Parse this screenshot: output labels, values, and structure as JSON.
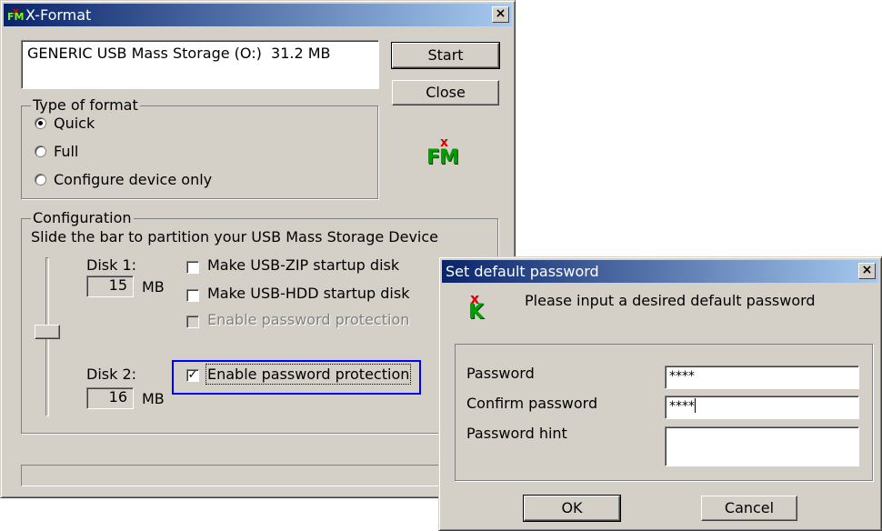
{
  "xformat": {
    "title": "X-Format",
    "close_glyph": "×",
    "device_text": "GENERIC USB Mass Storage (O:)  31.2 MB",
    "start_label": "Start",
    "close_label": "Close",
    "type_of_format": {
      "label": "Type of format",
      "options": [
        "Quick",
        "Full",
        "Configure device only"
      ],
      "selected": "Quick"
    },
    "logo_text": "FM",
    "logo_x": "x",
    "configuration": {
      "label": "Configuration",
      "instruction": "Slide the bar to partition your USB Mass Storage Device",
      "disk1_label": "Disk 1:",
      "disk1_value": "15",
      "disk1_unit": "MB",
      "disk2_label": "Disk 2:",
      "disk2_value": "16",
      "disk2_unit": "MB",
      "zip_label": "Make USB-ZIP startup disk",
      "hdd_label": "Make USB-HDD startup disk",
      "pw_disabled_label": "Enable password protection",
      "pw_label": "Enable password protection",
      "pw_check_glyph": "✓"
    }
  },
  "password_dialog": {
    "title": "Set default password",
    "close_glyph": "×",
    "logo_x": "x",
    "logo_k": "K",
    "prompt": "Please input a desired default password",
    "password_label": "Password",
    "password_value": "****",
    "confirm_label": "Confirm password",
    "confirm_value": "****",
    "hint_label": "Password hint",
    "hint_value": "",
    "ok_label": "OK",
    "cancel_label": "Cancel"
  },
  "colors": {
    "title_active": "#0a246a",
    "face": "#d4d0c8",
    "highlight_box": "#0000ff",
    "logo_red": "#e00000",
    "logo_green": "#008000"
  }
}
